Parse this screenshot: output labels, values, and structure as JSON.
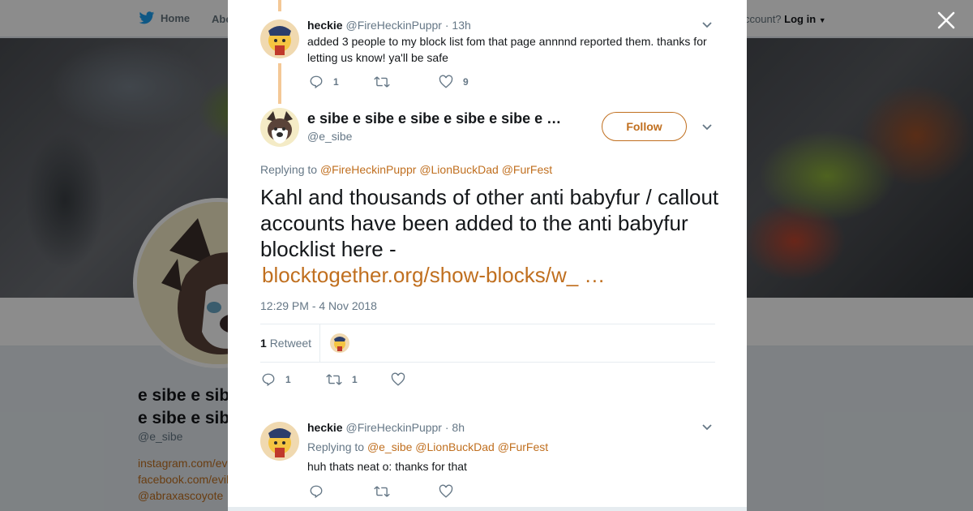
{
  "nav": {
    "home": "Home",
    "about": "Abo",
    "account_prompt": "ccount?",
    "login": "Log in"
  },
  "background_profile": {
    "name_line1": "e sibe e sib",
    "name_line2": "e sibe e sib",
    "handle": "@e_sibe",
    "links": [
      "instagram.com/ev",
      "facebook.com/evil",
      "@abraxascoyote"
    ]
  },
  "colors": {
    "accent": "#c06f1f",
    "thread_line": "#f4c896",
    "muted": "#657786"
  },
  "parent_tweet": {
    "name": "heckie",
    "handle": "@FireHeckinPuppr",
    "time": "· 13h",
    "text": "added 3 people to my block list fom that page annnnd reported them. thanks for letting us know! ya'll be safe",
    "replies": "1",
    "retweets": "",
    "likes": "9"
  },
  "main_tweet": {
    "name": "e sibe e sibe e sibe e sibe e sibe e …",
    "handle": "@e_sibe",
    "follow_label": "Follow",
    "replying_prefix": "Replying to",
    "replying_to": [
      "@FireHeckinPuppr",
      "@LionBuckDad",
      "@FurFest"
    ],
    "text": "Kahl and thousands of other anti babyfur / callout accounts have been added to the anti babyfur blocklist here -",
    "link": "blocktogether.org/show-blocks/w_ …",
    "timestamp": "12:29 PM - 4 Nov 2018",
    "retweet_count": "1",
    "retweet_label": "Retweet",
    "replies": "1",
    "retweets": "1",
    "likes": ""
  },
  "reply_tweet": {
    "name": "heckie",
    "handle": "@FireHeckinPuppr",
    "time": "· 8h",
    "replying_prefix": "Replying to",
    "replying_to": [
      "@e_sibe",
      "@LionBuckDad",
      "@FurFest"
    ],
    "text": "huh thats neat o: thanks for that",
    "replies": "",
    "retweets": "",
    "likes": ""
  },
  "icons": {
    "close": "close-icon",
    "reply": "reply-icon",
    "retweet": "retweet-icon",
    "like": "heart-icon",
    "caret": "chevron-down-icon",
    "logo": "bird-icon"
  }
}
